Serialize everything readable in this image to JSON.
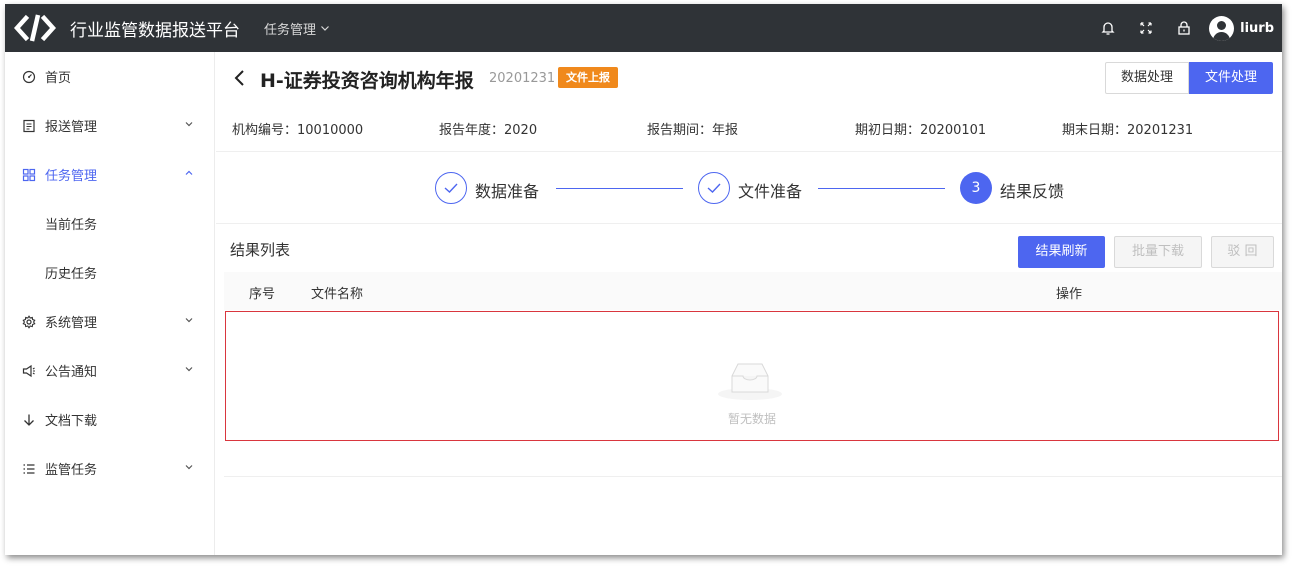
{
  "app": {
    "title": "行业监管数据报送平台",
    "top_menu_label": "任务管理",
    "username": "liurb"
  },
  "sidebar": {
    "items": [
      {
        "label": "首页",
        "icon": "dashboard-icon",
        "expandable": false
      },
      {
        "label": "报送管理",
        "icon": "report-icon",
        "expandable": true
      },
      {
        "label": "任务管理",
        "icon": "grid-icon",
        "expandable": true,
        "active": true
      },
      {
        "label": "当前任务",
        "sub": true
      },
      {
        "label": "历史任务",
        "sub": true
      },
      {
        "label": "系统管理",
        "icon": "gear-icon",
        "expandable": true
      },
      {
        "label": "公告通知",
        "icon": "megaphone-icon",
        "expandable": true
      },
      {
        "label": "文档下载",
        "icon": "download-icon",
        "expandable": false
      },
      {
        "label": "监管任务",
        "icon": "list-icon",
        "expandable": true
      }
    ]
  },
  "header": {
    "title": "H-证券投资咨询机构年报",
    "date": "20201231",
    "badge": "文件上报",
    "buttons": [
      "数据处理",
      "文件处理"
    ]
  },
  "info": {
    "org_code": "机构编号：10010000",
    "report_year": "报告年度：2020",
    "report_period": "报告期间：年报",
    "start_date": "期初日期：20200101",
    "end_date": "期末日期：20201231"
  },
  "steps": [
    {
      "label": "数据准备",
      "status": "done"
    },
    {
      "label": "文件准备",
      "status": "done"
    },
    {
      "label": "结果反馈",
      "status": "current",
      "number": "3"
    }
  ],
  "result": {
    "title": "结果列表",
    "refresh_button": "结果刷新",
    "batch_download_button": "批量下载",
    "reject_button": "驳 回",
    "columns": [
      "序号",
      "文件名称",
      "操作"
    ],
    "empty_text": "暂无数据"
  },
  "colors": {
    "primary": "#4d66f0",
    "topbar": "#2f3337",
    "badge": "#f0891c",
    "empty_border": "#d9363e"
  }
}
